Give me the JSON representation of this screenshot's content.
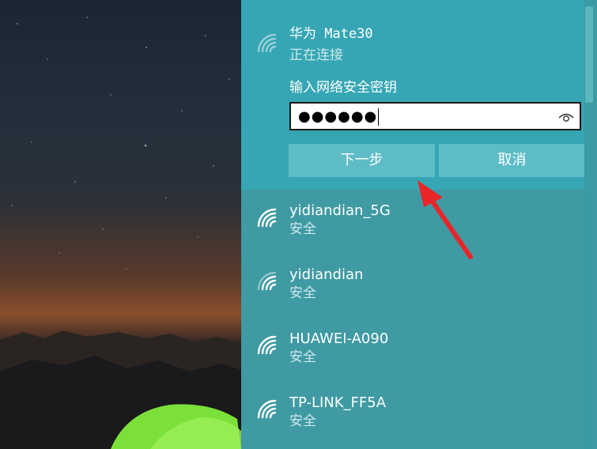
{
  "networks_panel": {
    "connecting": {
      "icon": "wifi-icon",
      "name": "华为 Mate30",
      "status": "正在连接",
      "key_label": "输入网络安全密钥",
      "password_masked": "●●●●●●",
      "reveal_icon": "eye-icon",
      "next_button": "下一步",
      "cancel_button": "取消"
    },
    "list": [
      {
        "name": "yidiandian_5G",
        "status": "安全",
        "icon": "wifi-icon"
      },
      {
        "name": "yidiandian",
        "status": "安全",
        "icon": "wifi-icon"
      },
      {
        "name": "HUAWEI-A090",
        "status": "安全",
        "icon": "wifi-icon"
      },
      {
        "name": "TP-LINK_FF5A",
        "status": "安全",
        "icon": "wifi-icon"
      }
    ]
  },
  "colors": {
    "panel": "#3f9aa3",
    "panel_active": "#36a6b4",
    "button": "#5ebcc7",
    "annotation_arrow": "#e8262a"
  }
}
